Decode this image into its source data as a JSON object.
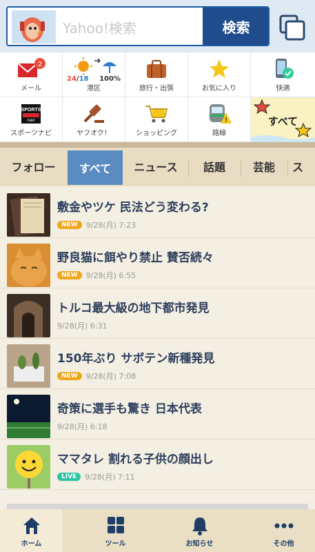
{
  "search": {
    "placeholder": "Yahoo!検索",
    "button": "検索"
  },
  "tools": [
    {
      "label": "メール",
      "icon": "mail-icon",
      "badge": "2"
    },
    {
      "label": "港区",
      "icon": "weather-icon",
      "temp_high": "24",
      "temp_low": "18",
      "rain": "100%"
    },
    {
      "label": "旅行・出張",
      "icon": "suitcase-icon"
    },
    {
      "label": "お気に入り",
      "icon": "star-icon"
    },
    {
      "label": "快適",
      "icon": "phone-check-icon"
    },
    {
      "label": "スポーツナビ",
      "icon": "sportsnavi-icon"
    },
    {
      "label": "ヤフオク！",
      "icon": "gavel-icon"
    },
    {
      "label": "ショッピング",
      "icon": "cart-icon"
    },
    {
      "label": "路線",
      "icon": "train-icon"
    },
    {
      "label": "すべて",
      "icon": "stars-icon"
    }
  ],
  "tabs": [
    "フォロー",
    "すべて",
    "ニュース",
    "話題",
    "芸能",
    "ス"
  ],
  "news": [
    {
      "title": "敷金やツケ 民法どう変わる?",
      "badge": "NEW",
      "time": "9/28(月) 7:23",
      "thumb": "book"
    },
    {
      "title": "野良猫に餌やり禁止 賛否続々",
      "badge": "NEW",
      "time": "9/28(月) 6:55",
      "thumb": "cat"
    },
    {
      "title": "トルコ最大級の地下都市発見",
      "badge": "",
      "time": "9/28(月) 6:31",
      "thumb": "tunnel"
    },
    {
      "title": "150年ぶり サボテン新種発見",
      "badge": "NEW",
      "time": "9/28(月) 7:08",
      "thumb": "cactus"
    },
    {
      "title": "奇策に選手も驚き 日本代表",
      "badge": "",
      "time": "9/28(月) 6:18",
      "thumb": "stadium"
    },
    {
      "title": "ママタレ 割れる子供の顔出し",
      "badge": "LIVE",
      "time": "9/28(月) 7:11",
      "thumb": "smiley"
    }
  ],
  "bottom_nav": [
    {
      "label": "ホーム",
      "icon": "home-icon"
    },
    {
      "label": "ツール",
      "icon": "grid-icon"
    },
    {
      "label": "お知らせ",
      "icon": "bell-icon"
    },
    {
      "label": "その他",
      "icon": "more-icon"
    }
  ],
  "colors": {
    "brand": "#1f4c8c",
    "tab_active": "#5a8cc1",
    "badge_new": "#f0a61c",
    "badge_live": "#2cc2a5"
  }
}
